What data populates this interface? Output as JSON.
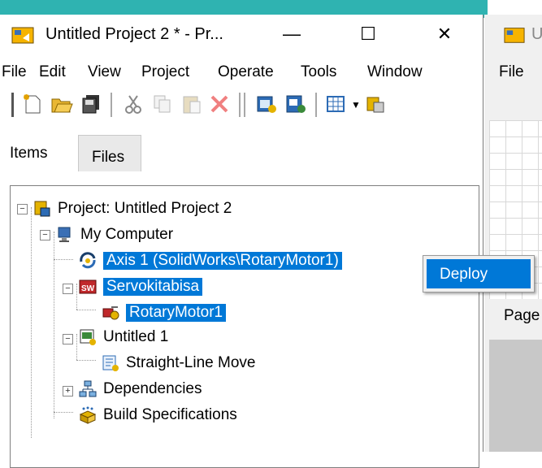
{
  "window": {
    "title": "Untitled Project 2 * - Pr...",
    "controls": {
      "minimize": "—",
      "maximize": "☐",
      "close": "✕"
    }
  },
  "menu": [
    "File",
    "Edit",
    "View",
    "Project",
    "Operate",
    "Tools",
    "Window"
  ],
  "tabs": {
    "items": "Items",
    "files": "Files"
  },
  "tree": {
    "project": "Project: Untitled Project 2",
    "my_computer": "My Computer",
    "axis": "Axis 1 (SolidWorks\\RotaryMotor1)",
    "servo": "Servokitabisa",
    "rotary": "RotaryMotor1",
    "untitled": "Untitled 1",
    "straight": "Straight-Line Move",
    "dependencies": "Dependencies",
    "build": "Build Specifications"
  },
  "context_menu": {
    "deploy": "Deploy"
  },
  "bg_window": {
    "title": "U",
    "menu": "File",
    "page": "Page"
  },
  "colors": {
    "selection": "#0078d7",
    "teal": "#2fb3b1"
  }
}
